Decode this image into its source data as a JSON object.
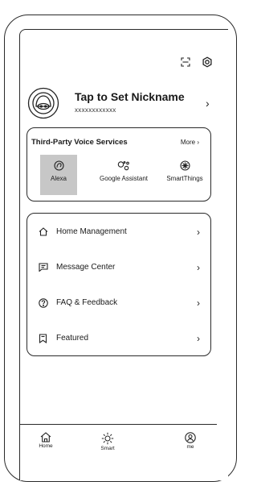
{
  "profile": {
    "nickname": "Tap to Set Nickname",
    "account_id": "xxxxxxxxxxxx"
  },
  "voice_services": {
    "title": "Third-Party Voice Services",
    "more_label": "More",
    "services": [
      {
        "label": "Alexa",
        "icon": "alexa-icon",
        "selected": true
      },
      {
        "label": "Google Assistant",
        "icon": "google-assistant-icon",
        "selected": false
      },
      {
        "label": "SmartThings",
        "icon": "smartthings-icon",
        "selected": false
      }
    ]
  },
  "menu": {
    "items": [
      {
        "label": "Home Management",
        "icon": "home-icon"
      },
      {
        "label": "Message Center",
        "icon": "message-icon"
      },
      {
        "label": "FAQ & Feedback",
        "icon": "question-icon"
      },
      {
        "label": "Featured",
        "icon": "bookmark-icon"
      }
    ]
  },
  "tabbar": {
    "tabs": [
      {
        "label": "Home",
        "icon": "home-tab-icon"
      },
      {
        "label": "Smart",
        "icon": "sun-icon"
      },
      {
        "label": "me",
        "icon": "user-icon"
      }
    ]
  }
}
